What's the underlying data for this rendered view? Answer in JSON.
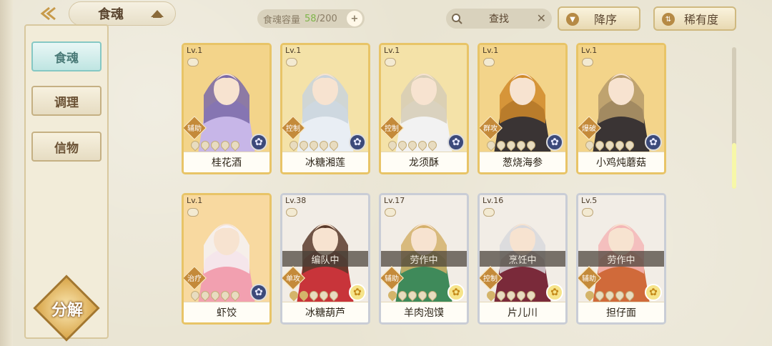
{
  "header": {
    "page_title": "食魂",
    "capacity_label": "食魂容量",
    "capacity_current": "58",
    "capacity_max": "/200",
    "capacity_add": "+",
    "search_label": "查找",
    "search_clear": "✕",
    "sort_order_label": "降序",
    "sort_by_label": "稀有度"
  },
  "sidebar": {
    "items": [
      {
        "label": "食魂"
      },
      {
        "label": "调理"
      },
      {
        "label": "信物"
      }
    ],
    "decompose_label": "分解"
  },
  "cards": [
    {
      "level": "Lv.1",
      "role": "辅助",
      "name": "桂花酒",
      "stars": 0,
      "element": "moon",
      "status": "",
      "frame": "gold",
      "palette": [
        "#f3d48a",
        "#c7b6e8",
        "#7a6aa8"
      ]
    },
    {
      "level": "Lv.1",
      "role": "控制",
      "name": "冰糖湘莲",
      "stars": 0,
      "element": "moon",
      "status": "",
      "frame": "gold",
      "palette": [
        "#f4e2a8",
        "#e9eef4",
        "#c9d3dc"
      ]
    },
    {
      "level": "Lv.1",
      "role": "控制",
      "name": "龙须酥",
      "stars": 0,
      "element": "moon",
      "status": "",
      "frame": "gold",
      "palette": [
        "#f4e2a8",
        "#f2f2f2",
        "#d6cdb6"
      ]
    },
    {
      "level": "Lv.1",
      "role": "群攻",
      "name": "葱烧海参",
      "stars": 0,
      "element": "moon",
      "status": "",
      "frame": "gold",
      "palette": [
        "#f3d48a",
        "#3a3434",
        "#d08a2a"
      ]
    },
    {
      "level": "Lv.1",
      "role": "爆破",
      "name": "小鸡炖蘑菇",
      "stars": 0,
      "element": "moon",
      "status": "",
      "frame": "gold",
      "palette": [
        "#f3d48a",
        "#3a3434",
        "#b59a6a"
      ]
    },
    {
      "level": "Lv.1",
      "role": "治疗",
      "name": "虾饺",
      "stars": 0,
      "element": "moon",
      "status": "",
      "frame": "gold",
      "palette": [
        "#f8d9a0",
        "#f2a0b0",
        "#f6f2f6"
      ]
    },
    {
      "level": "Lv.38",
      "role": "单攻",
      "name": "冰糖葫芦",
      "stars": 2,
      "element": "sun",
      "status": "编队中",
      "frame": "silver",
      "palette": [
        "#f2ede6",
        "#c8343a",
        "#5a3a2a"
      ]
    },
    {
      "level": "Lv.17",
      "role": "辅助",
      "name": "羊肉泡馍",
      "stars": 1,
      "element": "sun",
      "status": "劳作中",
      "frame": "silver",
      "palette": [
        "#f2ede6",
        "#3f8a5a",
        "#d4b06a"
      ]
    },
    {
      "level": "Lv.16",
      "role": "控制",
      "name": "片儿川",
      "stars": 1,
      "element": "sun",
      "status": "烹饪中",
      "frame": "silver",
      "palette": [
        "#f2ede6",
        "#7a2a3a",
        "#d8d8dc"
      ]
    },
    {
      "level": "Lv.5",
      "role": "辅助",
      "name": "担仔面",
      "stars": 1,
      "element": "sun",
      "status": "劳作中",
      "frame": "silver",
      "palette": [
        "#f2ede6",
        "#d06a3a",
        "#f4b6b6"
      ]
    }
  ]
}
